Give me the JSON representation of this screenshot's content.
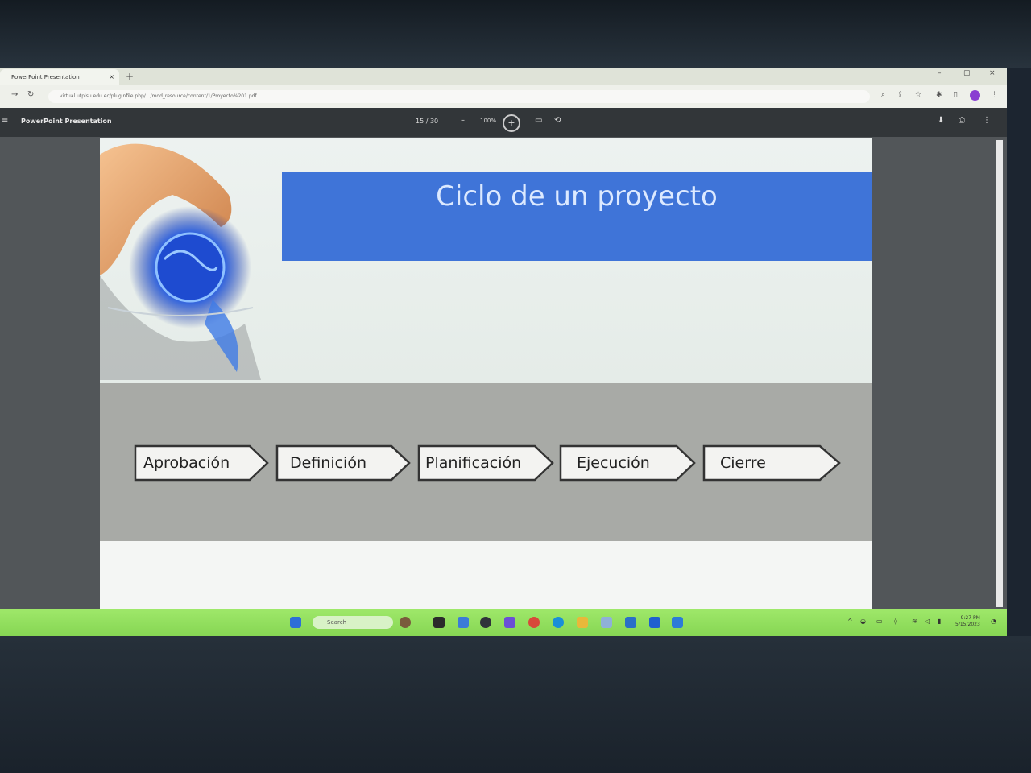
{
  "browser": {
    "tab_title": "PowerPoint Presentation",
    "tab_close": "×",
    "new_tab": "+",
    "minimize": "–",
    "maximize": "▢",
    "close": "×",
    "url": "virtual.utplsu.edu.ec/pluginfile.php/.../mod_resource/content/1/Proyecto%201.pdf"
  },
  "pdf_toolbar": {
    "doc_title": "PowerPoint Presentation",
    "page_indicator": "15 / 30",
    "zoom_minus": "–",
    "zoom_level": "100%",
    "zoom_plus": "+"
  },
  "slide": {
    "title": "Ciclo de un proyecto",
    "steps": [
      {
        "label": "Aprobación"
      },
      {
        "label": "Definición"
      },
      {
        "label": "Planificación"
      },
      {
        "label": "Ejecución"
      },
      {
        "label": "Cierre"
      }
    ]
  },
  "taskbar": {
    "search_placeholder": "Search",
    "time": "9:27 PM",
    "date": "5/15/2023"
  },
  "colors": {
    "title_box": "#3f74d8",
    "taskbar": "#93df5e",
    "band": "#a8aaa6"
  }
}
